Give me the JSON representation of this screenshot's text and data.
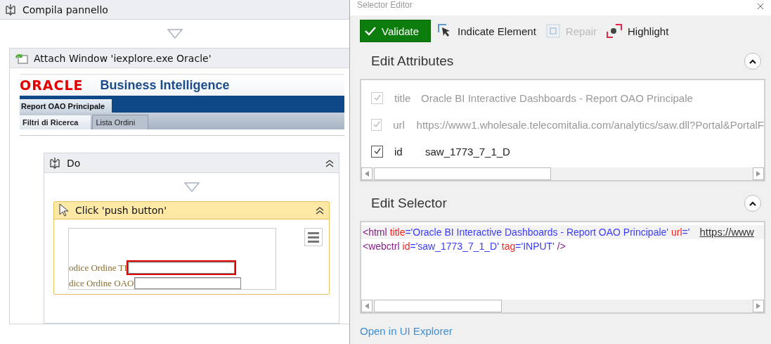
{
  "workflow": {
    "sequence": {
      "title": "Compila pannello"
    },
    "attach": {
      "title": "Attach Window 'iexplore.exe Oracle'",
      "screenshot": {
        "logo": "ORACLE",
        "product": "Business Intelligence",
        "dashboard_tab": "Report OAO Principale",
        "page_tabs": [
          {
            "label": "Filtri di Ricerca",
            "selected": true
          },
          {
            "label": "Lista Ordini",
            "selected": false
          }
        ]
      }
    },
    "do": {
      "title": "Do",
      "expanded": true,
      "click": {
        "title": "Click 'push button'",
        "expanded": true,
        "screenshot": {
          "fields": [
            {
              "label": "odice Ordine TI",
              "highlighted": true
            },
            {
              "label": "dice Ordine OAO",
              "highlighted": false
            }
          ]
        }
      }
    }
  },
  "editor": {
    "title": "Selector Editor",
    "toolbar": [
      {
        "label": "Validate",
        "kind": "validate",
        "disabled": false
      },
      {
        "label": "Indicate Element",
        "kind": "indicate",
        "disabled": false
      },
      {
        "label": "Repair",
        "kind": "repair",
        "disabled": true
      },
      {
        "label": "Highlight",
        "kind": "highlight",
        "disabled": false
      }
    ],
    "attributes": {
      "title": "Edit Attributes",
      "expanded": true,
      "rows": [
        {
          "name": "title",
          "value": "Oracle BI Interactive Dashboards - Report OAO Principale",
          "checked": true,
          "disabled": true
        },
        {
          "name": "url",
          "value": "https://www1.wholesale.telecomitalia.com/analytics/saw.dll?Portal&PortalF",
          "checked": true,
          "disabled": true
        },
        {
          "name": "id",
          "value": "saw_1773_7_1_D",
          "checked": true,
          "disabled": false
        }
      ]
    },
    "selector": {
      "title": "Edit Selector",
      "expanded": true,
      "lines": [
        [
          {
            "kind": "tag",
            "text": "<html"
          },
          {
            "kind": "attr",
            "text": "title"
          },
          {
            "kind": "punct",
            "text": "="
          },
          {
            "kind": "value",
            "text": "'Oracle BI Interactive Dashboards - Report OAO Principale'"
          },
          {
            "kind": "attr",
            "text": "url"
          },
          {
            "kind": "punct",
            "text": "='"
          },
          {
            "kind": "link",
            "text": "https://www"
          }
        ],
        [
          {
            "kind": "tag",
            "text": "<webctrl"
          },
          {
            "kind": "attr",
            "text": "id"
          },
          {
            "kind": "punct",
            "text": "="
          },
          {
            "kind": "value",
            "text": "'saw_1773_7_1_D'"
          },
          {
            "kind": "attr",
            "text": "tag"
          },
          {
            "kind": "punct",
            "text": "="
          },
          {
            "kind": "value",
            "text": "'INPUT'"
          },
          {
            "kind": "tag",
            "text": "/>"
          }
        ]
      ]
    },
    "footer_link": "Open in UI Explorer"
  }
}
